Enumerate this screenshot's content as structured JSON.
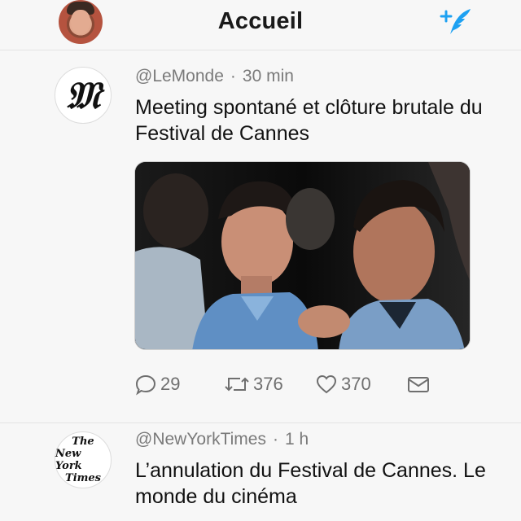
{
  "header": {
    "title": "Accueil",
    "compose_icon": "compose-tweet-icon",
    "accent_color": "#1da1f2"
  },
  "tweets": [
    {
      "handle": "@LeMonde",
      "separator": "·",
      "time": "30 min",
      "avatar_icon": "le-monde-logo",
      "text": "Meeting spontané et clôture brutale du Festival de Cannes",
      "reply_count": "29",
      "retweet_count": "376",
      "like_count": "370"
    },
    {
      "handle": "@NewYorkTimes",
      "separator": "·",
      "time": "1 h",
      "avatar_icon": "nyt-logo",
      "logo_text": [
        "The",
        "New York",
        "Times"
      ],
      "text": "L’annulation du Festival de Cannes. Le monde du cinéma"
    }
  ]
}
